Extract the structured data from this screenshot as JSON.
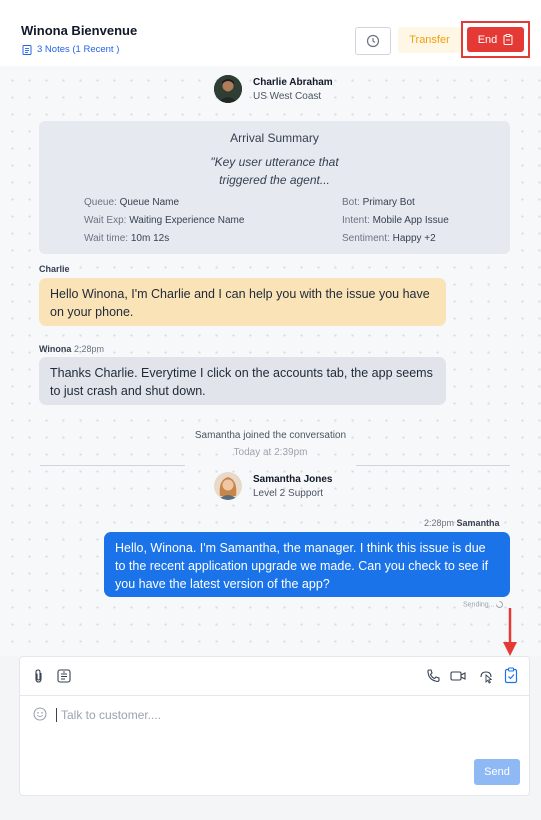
{
  "header": {
    "title": "Winona Bienvenue",
    "notes_label": "3 Notes (1 Recent )",
    "transfer_label": "Transfer",
    "end_label": "End"
  },
  "agent1": {
    "name": "Charlie Abraham",
    "subtitle": "US West Coast"
  },
  "summary": {
    "title": "Arrival Summary",
    "quote_line1": "\"Key user utterance that",
    "quote_line2": "triggered the agent...",
    "queue_label": "Queue:",
    "queue_value": "Queue Name",
    "waitexp_label": "Wait Exp:",
    "waitexp_value": "Waiting Experience Name",
    "waittime_label": "Wait time:",
    "waittime_value": "10m 12s",
    "bot_label": "Bot:",
    "bot_value": "Primary Bot",
    "intent_label": "Intent:",
    "intent_value": "Mobile App Issue",
    "sentiment_label": "Sentiment:",
    "sentiment_value": "Happy +2"
  },
  "messages": {
    "charlie_sender": "Charlie",
    "charlie_text": "Hello Winona, I'm Charlie and I can help you with the issue you have on your phone.",
    "winona_sender": "Winona",
    "winona_time": "2:28pm",
    "winona_text": "Thanks Charlie. Everytime I click on the accounts tab, the app seems to just crash and shut down.",
    "joined_text": "Samantha joined the conversation",
    "joined_time": "Today at 2:39pm",
    "sam_time": "2:28pm",
    "sam_sender": "Samantha",
    "sam_text": "Hello, Winona. I'm Samantha, the manager. I think this issue is due to the recent application upgrade we made. Can you check to see if you have the latest version of the app?",
    "sending": "Sending..."
  },
  "agent2": {
    "name": "Samantha Jones",
    "subtitle": "Level 2 Support"
  },
  "composer": {
    "placeholder": "Talk to customer....",
    "send_label": "Send"
  },
  "colors": {
    "end_red": "#e53935",
    "primary_blue": "#1a73e8",
    "charlie_bubble": "#fbe3b8",
    "transfer_orange": "#f59e0b"
  }
}
